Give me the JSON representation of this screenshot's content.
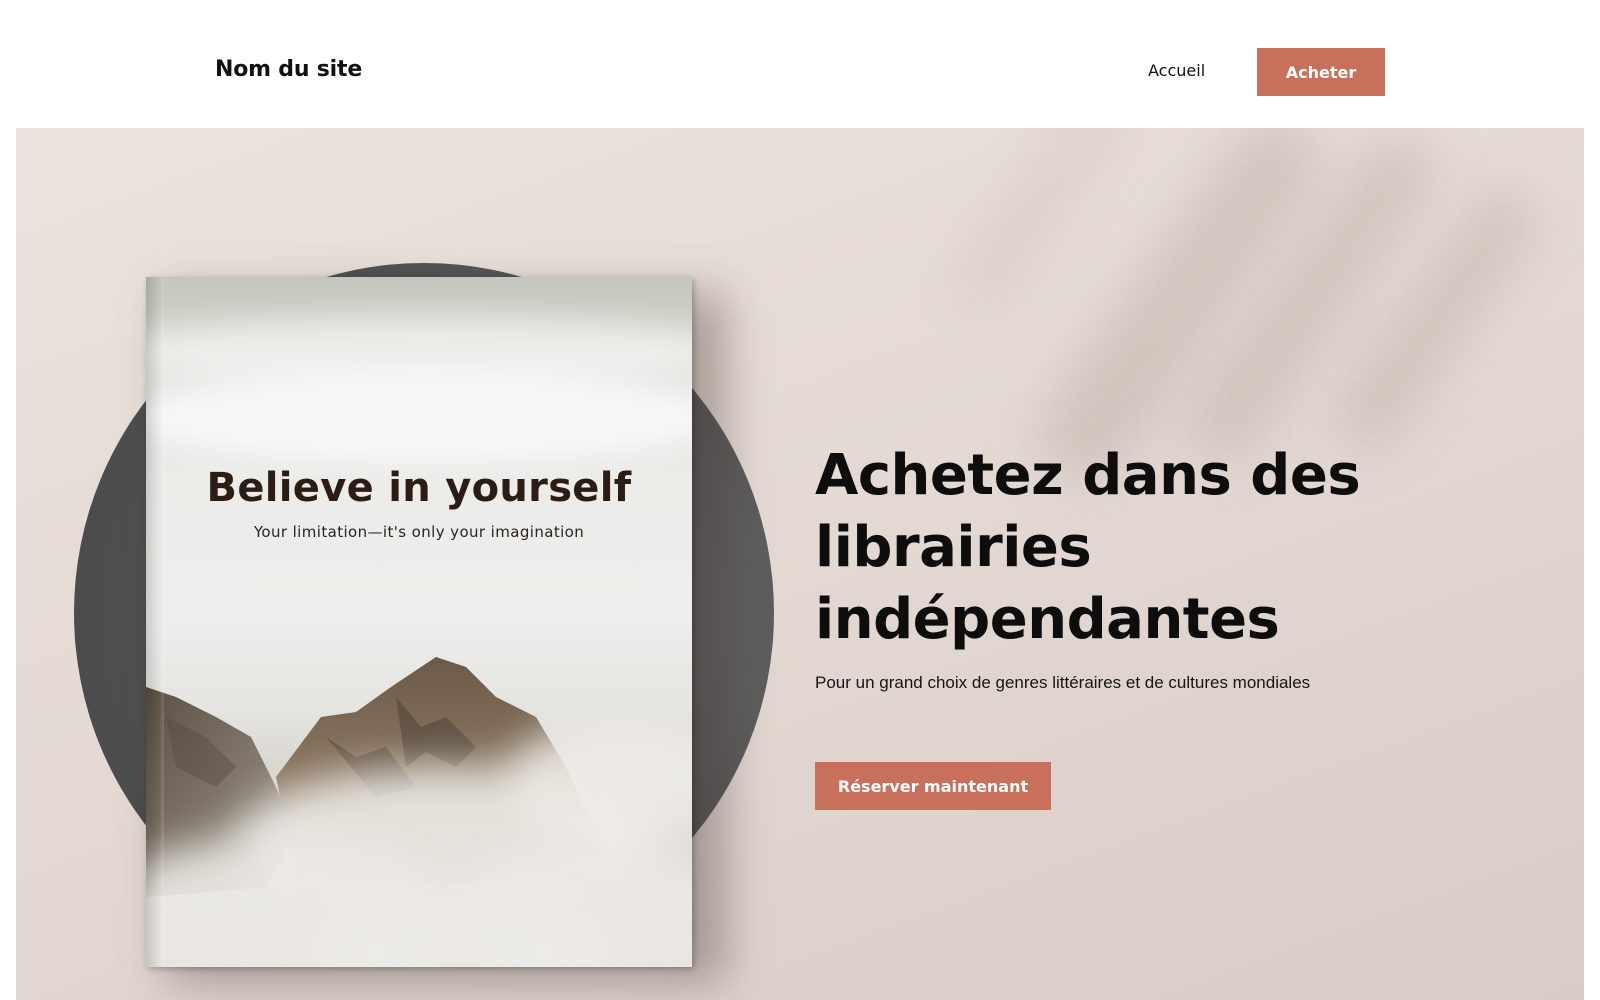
{
  "header": {
    "site_title": "Nom du site",
    "nav_home": "Accueil",
    "buy_label": "Acheter"
  },
  "hero": {
    "book": {
      "title": "Believe in yourself",
      "subtitle": "Your limitation—it's only your imagination"
    },
    "heading": "Achetez dans des librairies indépendantes",
    "subheading": "Pour un grand choix de genres littéraires et de cultures mondiales",
    "cta_label": "Réserver maintenant"
  },
  "colors": {
    "accent": "#c8705c",
    "background": "#e4d9d3",
    "text": "#0d0d0d"
  }
}
